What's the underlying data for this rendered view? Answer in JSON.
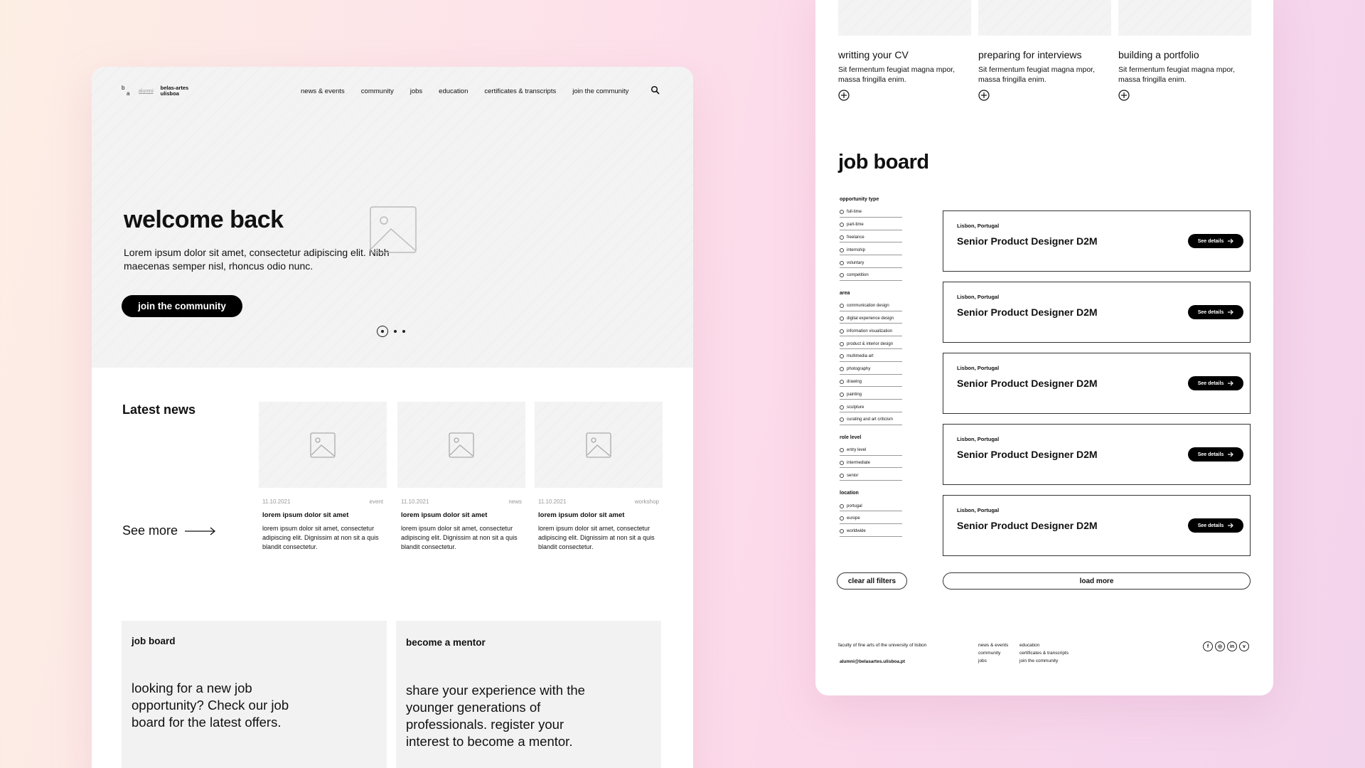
{
  "left": {
    "nav": {
      "logo_b": "b",
      "logo_a": "a",
      "logo_alumni": "alumni",
      "logo_line1": "belas-artes",
      "logo_line2": "ulisboa",
      "links": [
        "news & events",
        "community",
        "jobs",
        "education",
        "certificates & transcripts",
        "join the community"
      ],
      "search_icon": "search-icon"
    },
    "hero": {
      "title": "welcome back",
      "subtitle": "Lorem ipsum dolor sit amet, consectetur adipiscing elit. Nibh maecenas semper nisl, rhoncus odio nunc.",
      "button": "join the community"
    },
    "news": {
      "title": "Latest news",
      "see_more": "See more",
      "cards": [
        {
          "date": "11.10.2021",
          "tag": "event",
          "title": "lorem ipsum dolor sit amet",
          "body": "lorem ipsum dolor sit amet, consectetur adipiscing elit. Dignissim at non sit a quis blandit consectetur."
        },
        {
          "date": "11.10.2021",
          "tag": "news",
          "title": "lorem ipsum dolor sit amet",
          "body": "lorem ipsum dolor sit amet, consectetur adipiscing elit. Dignissim at non sit a quis blandit consectetur."
        },
        {
          "date": "11.10.2021",
          "tag": "workshop",
          "title": "lorem ipsum dolor sit amet",
          "body": "lorem ipsum dolor sit amet, consectetur adipiscing elit. Dignissim at non sit a quis blandit consectetur."
        }
      ]
    },
    "promos": [
      {
        "heading": "job board",
        "text": "looking for a new job opportunity? Check our job board for the latest offers."
      },
      {
        "heading": "become a mentor",
        "text": "share your experience with the younger generations of professionals. register your interest to become a mentor."
      }
    ]
  },
  "right": {
    "guides": [
      {
        "title": "writting your CV",
        "text": "Sit fermentum feugiat magna mpor, massa fringilla enim."
      },
      {
        "title": "preparing for interviews",
        "text": "Sit fermentum feugiat magna mpor, massa fringilla enim."
      },
      {
        "title": "building a portfolio",
        "text": "Sit fermentum feugiat magna mpor, massa fringilla enim."
      }
    ],
    "job_board_title": "job board",
    "filters": {
      "opportunity_type": {
        "label": "opportunity type",
        "items": [
          "full-time",
          "part-time",
          "freelance",
          "internship",
          "voluntary",
          "competition"
        ]
      },
      "area": {
        "label": "area",
        "items": [
          "communication design",
          "digital experience design",
          "information visualization",
          "product & interior design",
          "multimedia art",
          "photography",
          "drawing",
          "painting",
          "sculpture",
          "curating and art criticism"
        ]
      },
      "role_level": {
        "label": "role level",
        "items": [
          "entry level",
          "intermediate",
          "senior"
        ]
      },
      "location": {
        "label": "location",
        "items": [
          "portugal",
          "europe",
          "worldwide"
        ]
      }
    },
    "jobs": [
      {
        "location": "Lisbon, Portugal",
        "title": "Senior Product Designer D2M",
        "button": "See details"
      },
      {
        "location": "Lisbon, Portugal",
        "title": "Senior Product Designer D2M",
        "button": "See details"
      },
      {
        "location": "Lisbon, Portugal",
        "title": "Senior Product Designer D2M",
        "button": "See details"
      },
      {
        "location": "Lisbon, Portugal",
        "title": "Senior Product Designer D2M",
        "button": "See details"
      },
      {
        "location": "Lisbon, Portugal",
        "title": "Senior Product Designer D2M",
        "button": "See details"
      }
    ],
    "clear_filters": "clear all filters",
    "load_more": "load more",
    "footer": {
      "faculty": "faculty of fine arts of the university of lisbon",
      "email": "alumni@belasartes.ulisboa.pt",
      "col1": [
        "news & events",
        "community",
        "jobs"
      ],
      "col2": [
        "education",
        "certificates & transcripts",
        "join the community"
      ],
      "socials": [
        "facebook-icon",
        "instagram-icon",
        "linkedin-icon",
        "vimeo-icon"
      ]
    }
  }
}
